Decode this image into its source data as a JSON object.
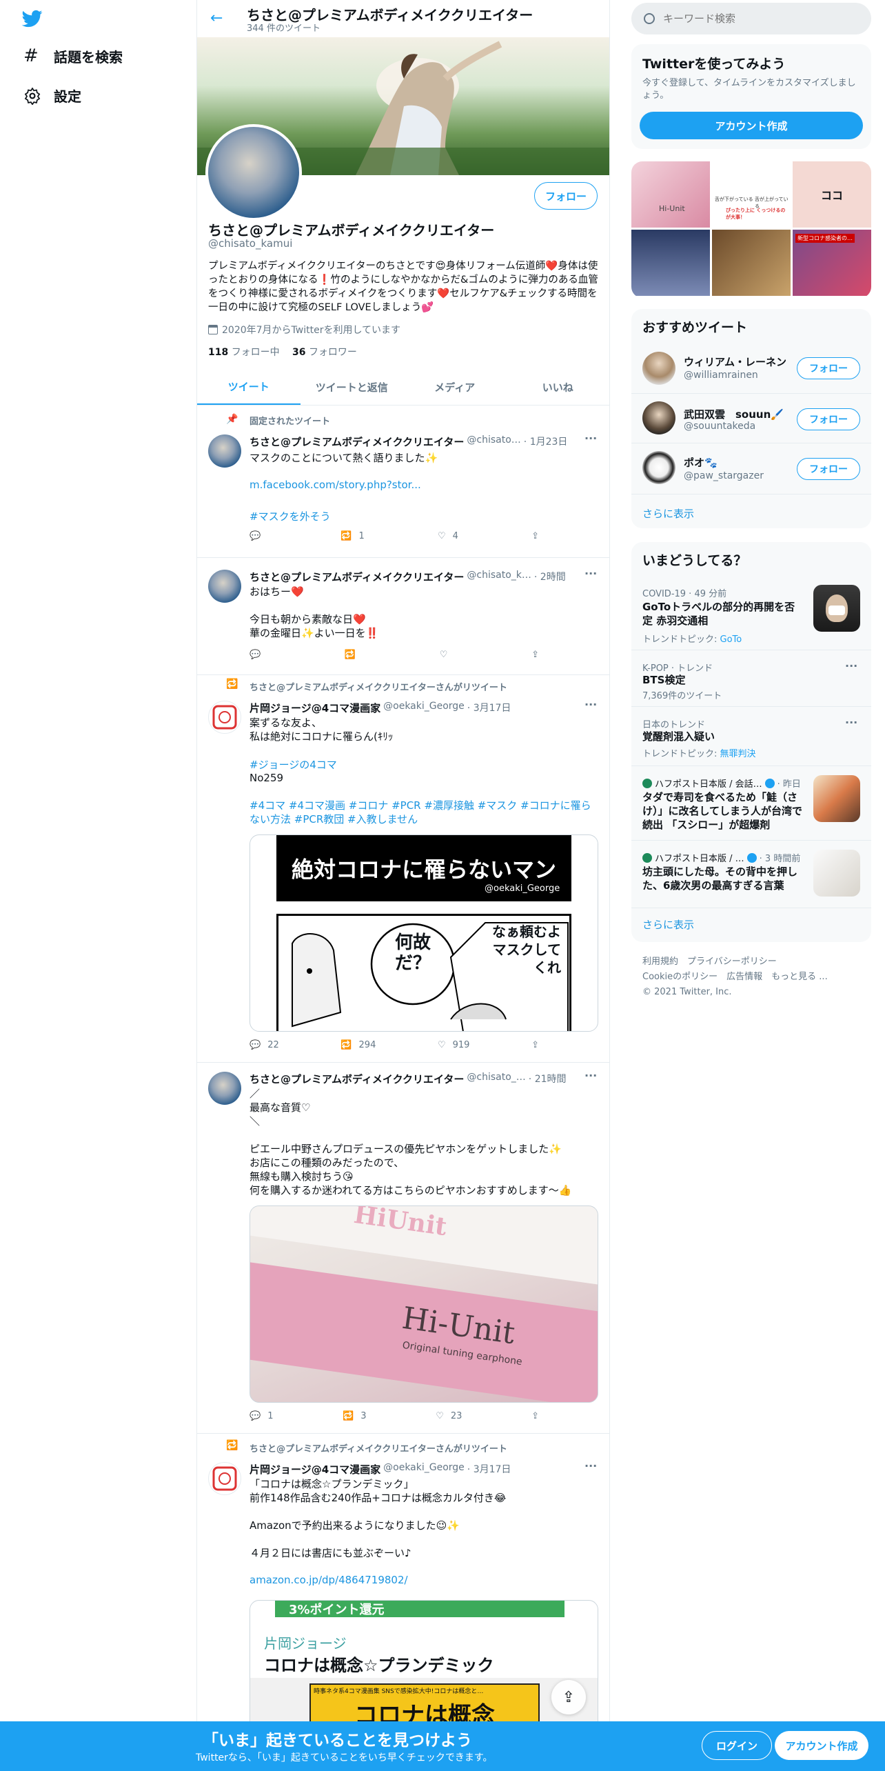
{
  "nav": {
    "explore": "話題を検索",
    "settings": "設定"
  },
  "header": {
    "name": "ちさと@プレミアムボディメイククリエイター",
    "tweet_count": "344 件のツイート"
  },
  "profile": {
    "name": "ちさと@プレミアムボディメイククリエイター",
    "handle": "@chisato_kamui",
    "follow_button": "フォロー",
    "bio": "プレミアムボディメイククリエイターのちさとです😍身体リフォーム伝道師❤️身体は使ったとおりの身体になる❗️竹のようにしなやかなからだ&ゴムのように弾力のある血管をつくり神様に愛されるボディメイクをつくります❤️セルフケア&チェックする時間を一日の中に設けて究極のSELF LOVEしましょう💕",
    "joined": "2020年7月からTwitterを利用しています",
    "following_count": "118",
    "following_label": "フォロー中",
    "followers_count": "36",
    "followers_label": "フォロワー"
  },
  "tabs": [
    "ツイート",
    "ツイートと返信",
    "メディア",
    "いいね"
  ],
  "tweets": [
    {
      "context": "固定されたツイート",
      "name": "ちさと@プレミアムボディメイククリエイター",
      "handle": "@chisato…",
      "time": "· 1月23日",
      "text": "マスクのことについて熱く語りました✨",
      "link1": "m.facebook.com/story.php?stor...",
      "link2": "#マスクを外そう",
      "reply": "",
      "retweet": "1",
      "like": "4"
    },
    {
      "name": "ちさと@プレミアムボディメイククリエイター",
      "handle": "@chisato_k…",
      "time": "· 2時間",
      "text": "おはちー❤️\n\n今日も朝から素敵な日❤️\n華の金曜日✨よい一日を‼️",
      "reply": "",
      "retweet": "",
      "like": ""
    },
    {
      "context": "ちさと@プレミアムボディメイククリエイターさんがリツイート",
      "name": "片岡ジョージ@4コマ漫画家",
      "handle": "@oekaki_George",
      "time": "· 3月17日",
      "text": "案ずるな友よ、\n私は絶対にコロナに罹らん(ｷﾘｯ",
      "hashtag": "#ジョージの4コマ",
      "no": "No259",
      "hashtags": "#4コマ #4コマ漫画 #コロナ #PCR #濃厚接触 #マスク #コロナに罹らない方法 #PCR教団 #入教しません",
      "comic_title": "絶対コロナに罹らないマン",
      "comic_credit": "@oekaki_George",
      "bubble1": "何故だ？",
      "bubble2": "なぁ頼むよマスクしてくれ",
      "reply": "22",
      "retweet": "294",
      "like": "919"
    },
    {
      "name": "ちさと@プレミアムボディメイククリエイター",
      "handle": "@chisato_…",
      "time": "· 21時間",
      "text": "／\n最高な音質♡\n＼\n\nピエール中野さんプロデュースの優先ピヤホンをゲットしました✨\nお店にこの種類のみだったので、\n無線も購入検討ちう😘\n何を購入するか迷われてる方はこちらのピヤホンおすすめします～👍",
      "product_brand": "Hi-Unit",
      "product_sub": "Original tuning earphone",
      "product_logo": "HiUnit",
      "reply": "1",
      "retweet": "3",
      "like": "23"
    },
    {
      "context": "ちさと@プレミアムボディメイククリエイターさんがリツイート",
      "name": "片岡ジョージ@4コマ漫画家",
      "handle": "@oekaki_George",
      "time": "· 3月17日",
      "text": "「コロナは概念☆プランデミック」\n前作148作品含む240作品+コロナは概念カルタ付き😂\n\nAmazonで予約出来るようになりました😉✨\n\n４月２日には書店にも並ぶぞーい♪",
      "link": "amazon.co.jp/dp/4864719802/",
      "book_banner": "3%ポイント還元",
      "book_author": "片岡ジョージ",
      "book_title": "コロナは概念☆プランデミック",
      "book_cover": "コロナは概念",
      "book_caption": "時事ネタ系4コマ漫画集 SNSで感染拡大中!コロナは概念と…"
    }
  ],
  "search": {
    "placeholder": "キーワード検索"
  },
  "signup": {
    "title": "Twitterを使ってみよう",
    "desc": "今すぐ登録して、タイムラインをカスタマイズしましょう。",
    "button": "アカウント作成"
  },
  "media_grid": {
    "m1": "Hi-Unit",
    "m2a": "舌が下がっている",
    "m2b": "ぴったり上に くっつけるのが大事！",
    "m2c": "舌が上がっている",
    "m3": "ココ",
    "m6": "新型コロナ感染者の…"
  },
  "who_to_follow": {
    "title": "おすすめツイート",
    "users": [
      {
        "name": "ウィリアム・レーネン",
        "handle": "@williamrainen",
        "button": "フォロー"
      },
      {
        "name": "武田双雲　souun🖌️",
        "handle": "@souuntakeda",
        "button": "フォロー"
      },
      {
        "name": "ポオ🐾",
        "handle": "@paw_stargazer",
        "button": "フォロー"
      }
    ],
    "more": "さらに表示"
  },
  "trends": {
    "title": "いまどうしてる？",
    "items": [
      {
        "meta": "COVID-19 · 49 分前",
        "title": "GoToトラベルの部分的再開を否定 赤羽交通相",
        "sub": "トレンドトピック: ",
        "sub_link": "GoTo"
      },
      {
        "meta": "K-POP · トレンド",
        "title": "BTS検定",
        "sub": "7,369件のツイート"
      },
      {
        "meta": "日本のトレンド",
        "title": "覚醒剤混入疑い",
        "sub": "トレンドトピック: ",
        "sub_link": "無罪判決"
      },
      {
        "meta": "ハフポスト日本版 / 会話…",
        "time": "· 昨日",
        "title": "タダで寿司を食べるため「鮭（さけ）」に改名してしまう人が台湾で続出 「スシロー」が超爆剤"
      },
      {
        "meta": "ハフポスト日本版 / …",
        "time": "· 3 時間前",
        "title": "坊主頭にした母。その背中を押した、6歳次男の最高すぎる言葉"
      }
    ],
    "more": "さらに表示"
  },
  "footer": {
    "line1a": "利用規約",
    "line1b": "プライバシーポリシー",
    "line2a": "Cookieのポリシー",
    "line2b": "広告情報",
    "line2c": "もっと見る ...",
    "copy": "© 2021 Twitter, Inc."
  },
  "bottom": {
    "title": "「いま」起きていることを見つけよう",
    "sub": "Twitterなら、「いま」起きていることをいち早くチェックできます。",
    "login": "ログイン",
    "signup": "アカウント作成"
  },
  "colors": {
    "brand": "#1da1f2",
    "text": "#0f1419",
    "secondary": "#657786"
  }
}
